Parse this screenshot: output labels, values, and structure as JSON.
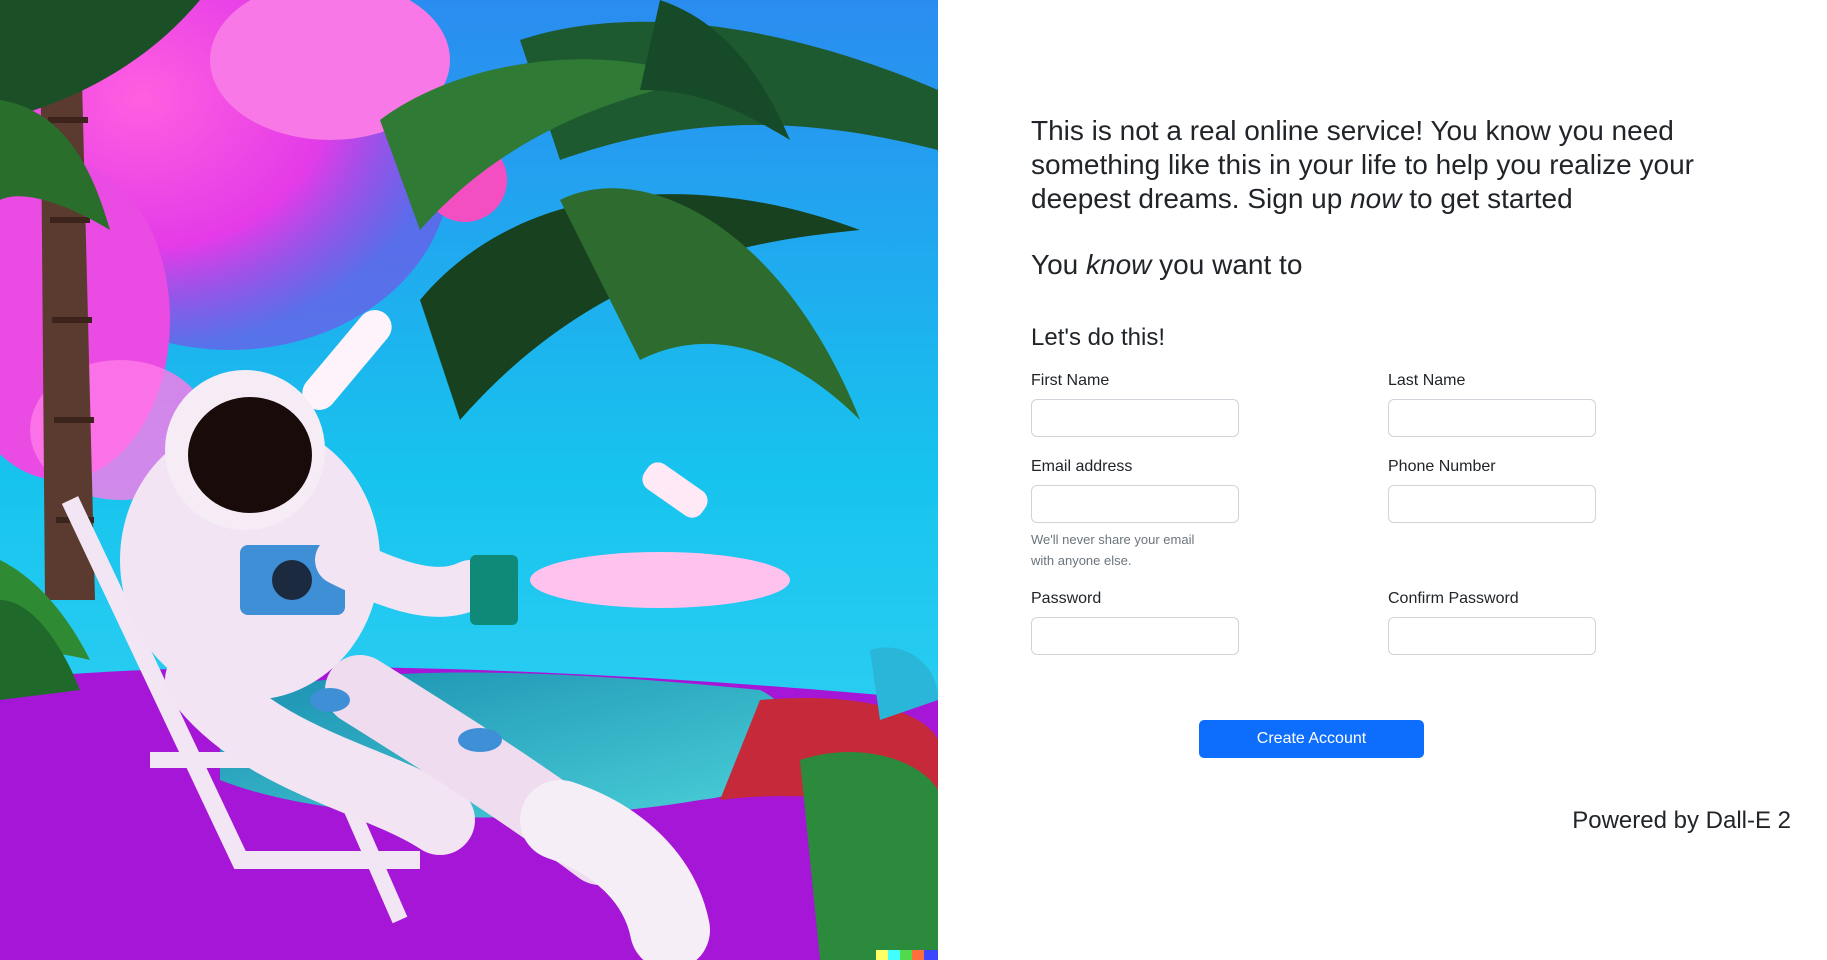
{
  "intro": {
    "text_before": "This is not a real online service! You know you need something like this in your life to help you realize your deepest dreams. Sign up ",
    "emphasis": "now",
    "text_after": " to get started"
  },
  "tagline": {
    "before": "You ",
    "emphasis": "know",
    "after": " you want to"
  },
  "form": {
    "heading": "Let's do this!",
    "first_name_label": "First Name",
    "last_name_label": "Last Name",
    "email_label": "Email address",
    "email_help": "We'll never share your email with anyone else.",
    "phone_label": "Phone Number",
    "password_label": "Password",
    "confirm_password_label": "Confirm Password",
    "submit_label": "Create Account"
  },
  "footer": {
    "text": "Powered by Dall-E 2"
  },
  "colors": {
    "primary": "#0d6efd",
    "text": "#212529",
    "muted": "#6c757d",
    "input_border": "#ced4da"
  },
  "image": {
    "description_icon": "astronaut-palm-pool-illustration"
  }
}
